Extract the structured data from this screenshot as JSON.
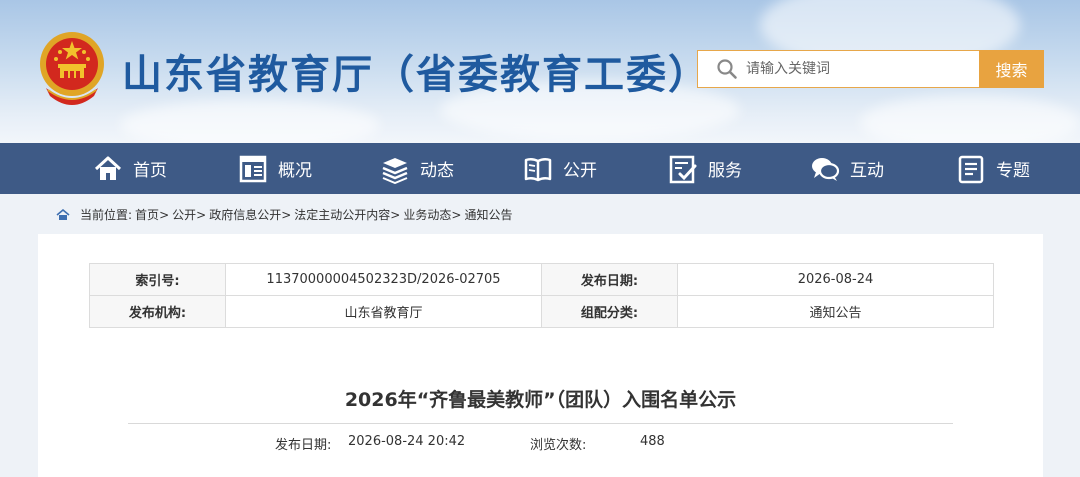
{
  "header": {
    "site_title": "山东省教育厅（省委教育工委）",
    "search_placeholder": "请输入关键词",
    "search_button": "搜索"
  },
  "nav": {
    "items": [
      {
        "label": "首页",
        "icon": "home-icon"
      },
      {
        "label": "概况",
        "icon": "overview-icon"
      },
      {
        "label": "动态",
        "icon": "news-icon"
      },
      {
        "label": "公开",
        "icon": "book-icon"
      },
      {
        "label": "服务",
        "icon": "service-icon"
      },
      {
        "label": "互动",
        "icon": "chat-icon"
      },
      {
        "label": "专题",
        "icon": "topic-icon"
      }
    ]
  },
  "breadcrumb": {
    "prefix": "当前位置:",
    "items": [
      "首页",
      "公开",
      "政府信息公开",
      "法定主动公开内容",
      "业务动态",
      "通知公告"
    ],
    "separator": ">"
  },
  "meta_table": {
    "index_label": "索引号:",
    "index_value": "11370000004502323D/2026-02705",
    "date_label": "发布日期:",
    "date_value": "2026-08-24",
    "org_label": "发布机构:",
    "org_value": "山东省教育厅",
    "category_label": "组配分类:",
    "category_value": "通知公告"
  },
  "article": {
    "title": "2026年“齐鲁最美教师”（团队）入围名单公示",
    "publish_label": "发布日期:",
    "publish_value": "2026-08-24 20:42",
    "views_label": "浏览次数:",
    "views_value": "488"
  },
  "colors": {
    "nav_bg": "#3e5a86",
    "title_blue": "#1f5a9f",
    "accent_orange": "#e8a340"
  }
}
